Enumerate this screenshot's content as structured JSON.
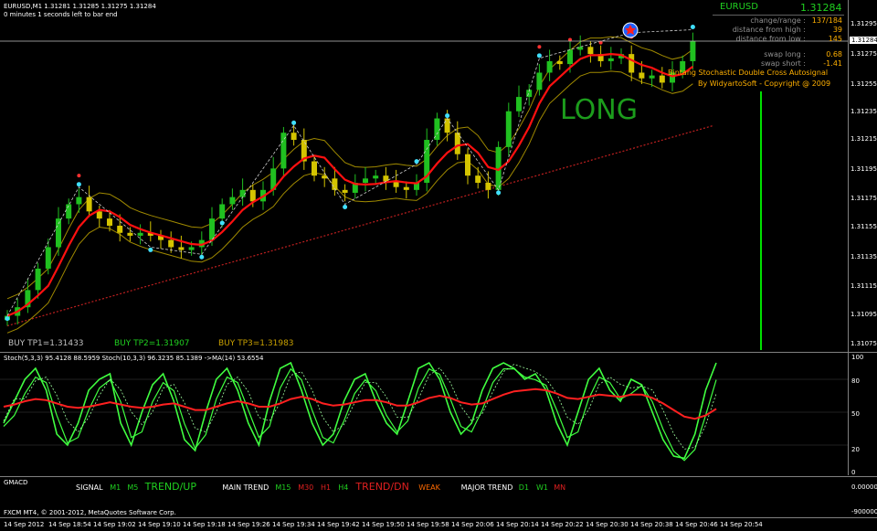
{
  "window": {
    "symbol_line": "EURUSD,M1  1.31281 1.31285 1.31275 1.31284",
    "bar_timer": "0 minutes 1 seconds left to bar end"
  },
  "info_panel": {
    "symbol": "EURUSD",
    "price": "1.31284",
    "rows": [
      {
        "label": "change/range  :",
        "value": "137/184"
      },
      {
        "label": "distance from high  :",
        "value": "39"
      },
      {
        "label": "distance from low  :",
        "value": "145"
      },
      {
        "label": "swap long  :",
        "value": "0.68"
      },
      {
        "label": "swap short  :",
        "value": "-1.41"
      }
    ]
  },
  "signal_text": {
    "title": "Bintang Stochastic Double Cross Autosignal",
    "credit": "By WidyartoSoft - Copyright @ 2009",
    "direction": "LONG"
  },
  "targets": [
    {
      "label": "BUY TP1=1.31433",
      "color": "#c0c0c0"
    },
    {
      "label": "BUY TP2=1.31907",
      "color": "#20d020"
    },
    {
      "label": "BUY TP3=1.31983",
      "color": "#c8a000"
    }
  ],
  "price_axis": [
    "1.31295",
    "1.31284",
    "1.31275",
    "1.31255",
    "1.31235",
    "1.31215",
    "1.31195",
    "1.31175",
    "1.31155",
    "1.31135",
    "1.31115",
    "1.31095",
    "1.31075"
  ],
  "current_price_tag": "1.31284",
  "stoch_panel": {
    "header": "Stoch(5,3,3) 95.4128 88.5959   Stoch(10,3,3) 96.3235 85.1389   ->MA(14) 53.6554",
    "axis": [
      "100",
      "80",
      "50",
      "20",
      "0"
    ]
  },
  "gmacd_panel": {
    "name": "GMACD",
    "groups": [
      {
        "label": "SIGNAL",
        "items": [
          {
            "text": "M1",
            "color": "#20d020"
          },
          {
            "text": "M5",
            "color": "#20d020"
          },
          {
            "text": "TREND/UP",
            "color": "#20d020",
            "big": true
          }
        ]
      },
      {
        "label": "MAIN TREND",
        "items": [
          {
            "text": "M15",
            "color": "#20d020"
          },
          {
            "text": "M30",
            "color": "#e02020"
          },
          {
            "text": "H1",
            "color": "#e02020"
          },
          {
            "text": "H4",
            "color": "#20d020"
          },
          {
            "text": "TREND/DN",
            "color": "#e02020",
            "big": true
          },
          {
            "text": "WEAK",
            "color": "#ff6a00"
          }
        ]
      },
      {
        "label": "MAJOR TREND",
        "items": [
          {
            "text": "D1",
            "color": "#20d020"
          },
          {
            "text": "W1",
            "color": "#20d020"
          },
          {
            "text": "MN",
            "color": "#e02020"
          }
        ]
      }
    ],
    "axis": [
      "0.000000",
      "-9000000"
    ]
  },
  "footer": "FXCM MT4, © 2001-2012, MetaQuotes Software Corp.",
  "time_axis": [
    "14 Sep 2012",
    "14 Sep 18:54",
    "14 Sep 19:02",
    "14 Sep 19:10",
    "14 Sep 19:18",
    "14 Sep 19:26",
    "14 Sep 19:34",
    "14 Sep 19:42",
    "14 Sep 19:50",
    "14 Sep 19:58",
    "14 Sep 20:06",
    "14 Sep 20:14",
    "14 Sep 20:22",
    "14 Sep 20:30",
    "14 Sep 20:38",
    "14 Sep 20:46",
    "14 Sep 20:54"
  ],
  "colors": {
    "bull_candle": "#20c020",
    "bear_candle": "#d4c400",
    "ma_fast": "#ff1010",
    "ma_slow_dotted": "#c02020",
    "envelope": "#a08a00",
    "stoch_main": "#40ff40",
    "stoch_ma": "#ff2020",
    "vertical_marker": "#00e000"
  },
  "chart_data": {
    "type": "line",
    "price_series_close": [
      1.31092,
      1.31098,
      1.3111,
      1.31125,
      1.3114,
      1.3116,
      1.3117,
      1.31175,
      1.31165,
      1.3116,
      1.31155,
      1.3115,
      1.31148,
      1.3115,
      1.31148,
      1.31145,
      1.3114,
      1.31138,
      1.3114,
      1.31145,
      1.3116,
      1.3117,
      1.31175,
      1.3118,
      1.31172,
      1.3118,
      1.31195,
      1.3122,
      1.31215,
      1.312,
      1.3119,
      1.31188,
      1.3118,
      1.31178,
      1.31185,
      1.31188,
      1.3119,
      1.31186,
      1.31182,
      1.3118,
      1.31185,
      1.31215,
      1.3123,
      1.3122,
      1.31205,
      1.3119,
      1.31185,
      1.3118,
      1.3121,
      1.31235,
      1.31245,
      1.3125,
      1.31262,
      1.3127,
      1.31268,
      1.31278,
      1.3128,
      1.31275,
      1.3127,
      1.31272,
      1.31275,
      1.31262,
      1.31258,
      1.3126,
      1.31255,
      1.31262,
      1.3127,
      1.31284
    ],
    "stoch_main": [
      40,
      60,
      80,
      90,
      70,
      30,
      20,
      40,
      70,
      80,
      85,
      40,
      20,
      50,
      75,
      85,
      60,
      25,
      15,
      50,
      80,
      90,
      70,
      40,
      20,
      60,
      90,
      95,
      70,
      40,
      20,
      30,
      60,
      80,
      85,
      60,
      40,
      30,
      60,
      90,
      95,
      80,
      50,
      30,
      40,
      70,
      90,
      95,
      90,
      80,
      85,
      70,
      40,
      20,
      50,
      80,
      90,
      70,
      60,
      80,
      75,
      50,
      25,
      10,
      8,
      30,
      70,
      95
    ],
    "stoch_ma": [
      55,
      57,
      60,
      62,
      61,
      58,
      55,
      54,
      55,
      57,
      59,
      57,
      55,
      54,
      55,
      57,
      58,
      55,
      52,
      52,
      55,
      58,
      60,
      58,
      55,
      55,
      58,
      62,
      64,
      62,
      58,
      56,
      57,
      59,
      61,
      61,
      59,
      56,
      56,
      59,
      63,
      65,
      63,
      59,
      57,
      58,
      62,
      66,
      69,
      70,
      71,
      70,
      67,
      63,
      62,
      64,
      66,
      65,
      64,
      66,
      66,
      63,
      58,
      52,
      46,
      44,
      47,
      53
    ],
    "ylabel": "",
    "xlabel": ""
  }
}
